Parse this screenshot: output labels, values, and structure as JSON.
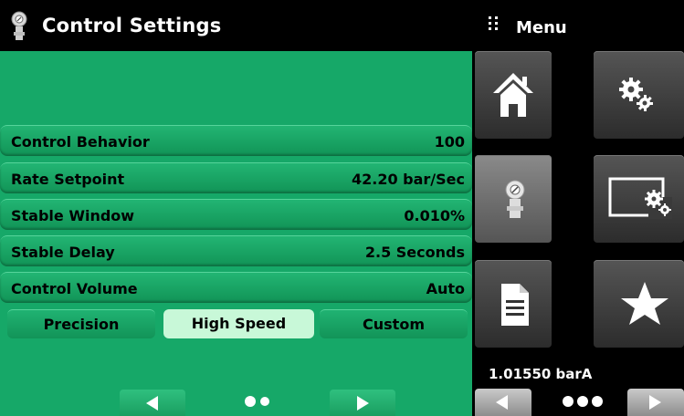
{
  "header": {
    "title": "Control Settings",
    "menu_label": "Menu"
  },
  "settings": [
    {
      "label": "Control Behavior",
      "value": "100"
    },
    {
      "label": "Rate Setpoint",
      "value": "42.20 bar/Sec"
    },
    {
      "label": "Stable Window",
      "value": "0.010%"
    },
    {
      "label": "Stable Delay",
      "value": "2.5 Seconds"
    },
    {
      "label": "Control Volume",
      "value": "Auto"
    }
  ],
  "modes": [
    {
      "label": "Precision",
      "active": false
    },
    {
      "label": "High Speed",
      "active": true
    },
    {
      "label": "Custom",
      "active": false
    }
  ],
  "pager": {
    "page": 2,
    "pages": 2
  },
  "menu": {
    "tiles": [
      "home-icon",
      "settings-gears-icon",
      "controller-icon",
      "display-settings-icon",
      "document-icon",
      "favorites-star-icon"
    ],
    "selected": "controller-icon"
  },
  "reading": "1.01550 barA",
  "menu_pager": {
    "page": 1,
    "pages": 3
  },
  "colors": {
    "panel": "#16a868",
    "active_mode": "#c8f8d8",
    "tile": "#3a3a3a"
  }
}
